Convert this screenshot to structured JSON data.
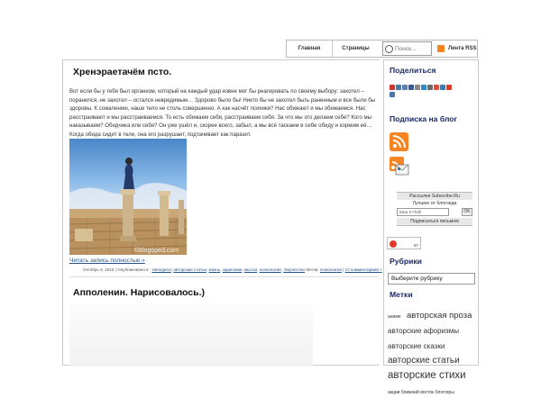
{
  "nav": {
    "home": "Главная",
    "pages": "Страницы",
    "search_placeholder": "Поиск...",
    "rss": "Лента RSS"
  },
  "post1": {
    "title": "Хренэраетачём псто.",
    "body": "Вот если бы у тебя был организм, который на каждый удар извне мог бы реагировать по своему выбору: захотел – поранился, не захотел – остался невредимым… Здорово было бы! Никто бы не захотел быть раненным и все были бы здоровы. К сожалению, наше тело не столь совершенно. А как насчёт психики? Нас обижают и мы обижаемся. Нас расстраивают и мы расстраиваемся. То есть обижаем себя, расстраиваем себя. За что мы это делаем себе? Кого мы наказываем? Обидчика или себя? Он уже ушёл и, скорее всего, забыл, а мы всё таскаем в себе обиду и кормим её… Когда обида сидит в теле, она его разрушает, подтачивает как паразит.",
    "image_caption": "©blogoped.com",
    "readmore": "Читать запись полностью »",
    "meta_prefix": "Октябрь 9, 2015 | Опубликовано в :",
    "meta_links": [
      "Непедагог",
      "авторские статьи",
      "жизнь",
      "зарисовки",
      "мысли",
      "психология",
      "творчество"
    ],
    "meta_tags_prefix": "Метки:",
    "meta_tag": "психология",
    "comments": "17 комментариев »"
  },
  "post2": {
    "title": "Апполенин. Нарисовалось.)"
  },
  "sidebar": {
    "share_title": "Поделиться",
    "share_icon_colors": [
      "#cc3333",
      "#4a76a8",
      "#5b7fb2",
      "#3b5998",
      "#888888",
      "#2e87c7",
      "#6a6a6a",
      "#dd4b39",
      "#3b79b5",
      "#e03b2a",
      "#4a76a8"
    ],
    "subscribe_title": "Подписка на блог",
    "subscribe_head": "Рассылки Subscribe.Ru",
    "subscribe_sub": "Лучшее от блогоеда",
    "email_placeholder": "ваш e-mail",
    "ok_label": "OK",
    "subscribe_foot": "Подписаться письмом",
    "counter_value": "57",
    "rubrics_title": "Рубрики",
    "rubric_select": "Выберите рубрику",
    "tags_title": "Метки",
    "tags": [
      {
        "text": "аниме",
        "size": 5
      },
      {
        "text": "авторская проза",
        "size": 9.5
      },
      {
        "text": "авторские афоризмы",
        "size": 8
      },
      {
        "text": "авторские сказки",
        "size": 8
      },
      {
        "text": "авторские статьи",
        "size": 10
      },
      {
        "text": "авторские стихи",
        "size": 11.5
      },
      {
        "text": "акции ближний восток блоггеры",
        "size": 5
      }
    ]
  }
}
